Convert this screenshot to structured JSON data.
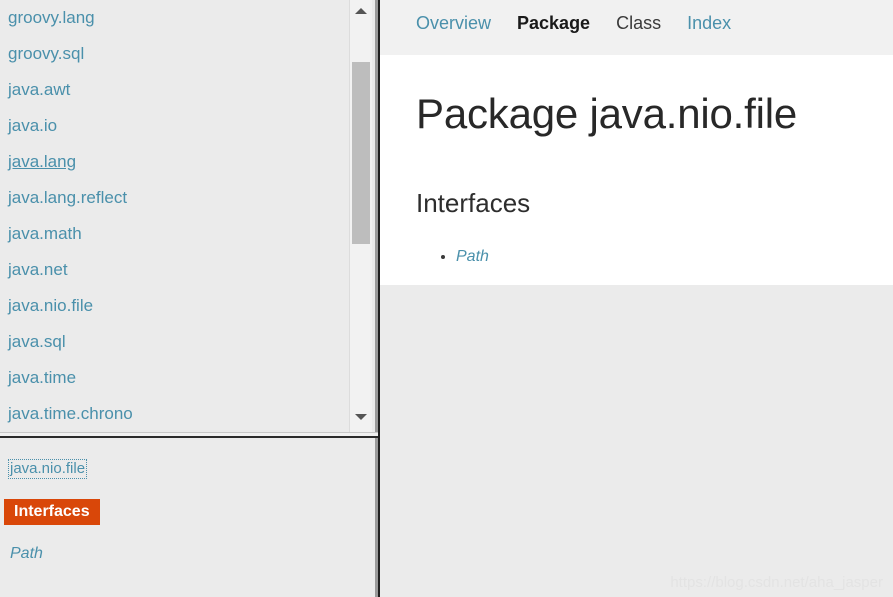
{
  "package_list": {
    "scroll_up_icon": "triangle-up-icon",
    "scroll_down_icon": "triangle-down-icon",
    "items": [
      {
        "label": "groovy.lang",
        "hovered": false
      },
      {
        "label": "groovy.sql",
        "hovered": false
      },
      {
        "label": "java.awt",
        "hovered": false
      },
      {
        "label": "java.io",
        "hovered": false
      },
      {
        "label": "java.lang",
        "hovered": true
      },
      {
        "label": "java.lang.reflect",
        "hovered": false
      },
      {
        "label": "java.math",
        "hovered": false
      },
      {
        "label": "java.net",
        "hovered": false
      },
      {
        "label": "java.nio.file",
        "hovered": false
      },
      {
        "label": "java.sql",
        "hovered": false
      },
      {
        "label": "java.time",
        "hovered": false
      },
      {
        "label": "java.time.chrono",
        "hovered": false
      }
    ]
  },
  "package_detail": {
    "title": "java.nio.file",
    "section_badge": "Interfaces",
    "badge_color": "#d94709",
    "entries": [
      {
        "label": "Path"
      }
    ]
  },
  "topnav": {
    "links": [
      {
        "label": "Overview",
        "state": "link"
      },
      {
        "label": "Package",
        "state": "active"
      },
      {
        "label": "Class",
        "state": "disabled"
      },
      {
        "label": "Index",
        "state": "link"
      }
    ]
  },
  "content": {
    "page_title": "Package java.nio.file",
    "section_title": "Interfaces",
    "interfaces": [
      {
        "label": "Path"
      }
    ]
  },
  "watermark": {
    "text": "https://blog.csdn.net/aha_jasper"
  },
  "colors": {
    "link": "#4a90ab",
    "accent": "#d94709",
    "frame_bg": "#ebebeb",
    "nav_bg": "#f1f1f1",
    "content_bg": "#ffffff"
  }
}
